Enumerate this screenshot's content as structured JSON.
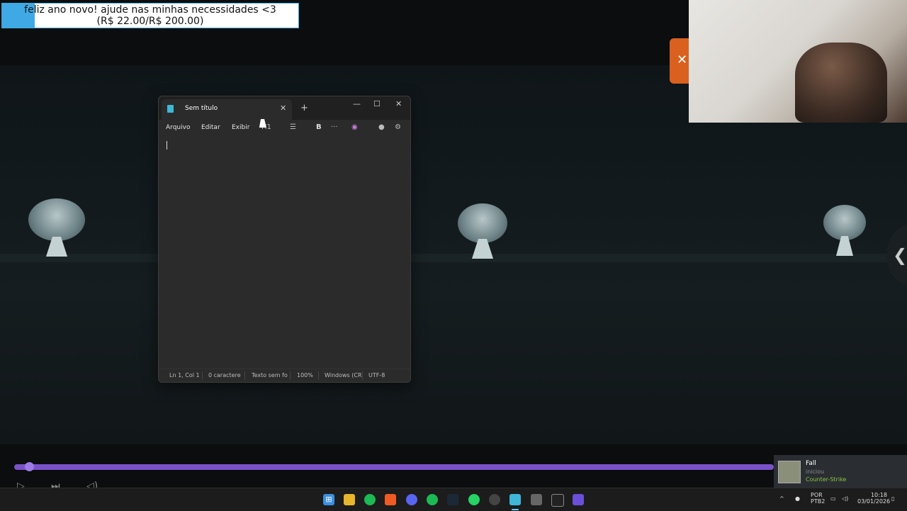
{
  "donation": {
    "line1": "feliz ano novo! ajude nas minhas necessidades <3",
    "line2": "(R$ 22.00/R$ 200.00)",
    "progress": 0.11
  },
  "overlay": {
    "close_glyph": "✕",
    "side_arrow_glyph": "❮"
  },
  "notepad": {
    "tab_title": "Sem título",
    "tab_close": "✕",
    "new_tab": "+",
    "win_minimize": "—",
    "win_maximize": "☐",
    "win_close": "✕",
    "menus": [
      "Arquivo",
      "Editar",
      "Exibir"
    ],
    "toolbar": {
      "heading": "H1",
      "list": "☰",
      "bold": "B",
      "more": "···",
      "copilot": "◉",
      "settings": "⚙"
    },
    "status": [
      "Ln 1, Col 1",
      "0 caractere",
      "Texto sem fo",
      "100%",
      "Windows (CR",
      "UTF-8"
    ]
  },
  "player": {
    "progress": 0.02
  },
  "toast": {
    "name": "Fall",
    "status": "iniciou",
    "game": "Counter-Strike"
  },
  "taskbar": {
    "lang_top": "POR",
    "lang_bottom": "PTB2",
    "time": "10:18",
    "date": "03/01/2026"
  }
}
